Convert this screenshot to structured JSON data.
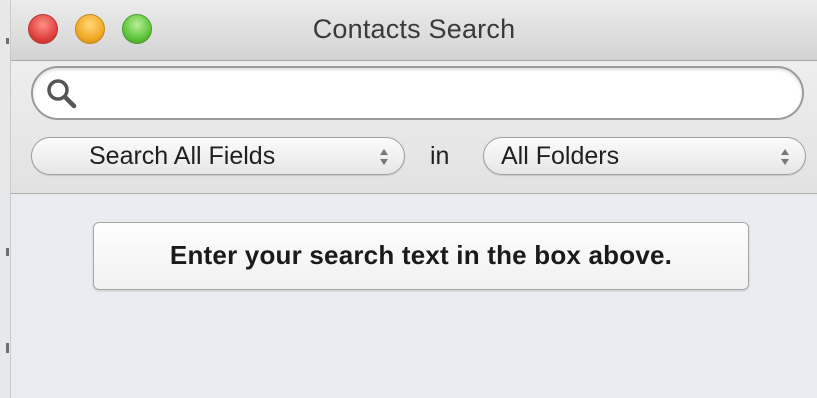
{
  "window": {
    "title": "Contacts Search"
  },
  "search": {
    "value": "",
    "placeholder": ""
  },
  "scope": {
    "field_selected": "Search All Fields",
    "connector": "in",
    "folder_selected": "All Folders"
  },
  "message": {
    "text": "Enter your search text in the box above."
  },
  "icons": {
    "search": "magnifier-icon",
    "stepper": "up-down-arrows-icon"
  },
  "colors": {
    "close": "#e0443e",
    "minimize": "#f2aa26",
    "zoom": "#5fc63b",
    "content_background": "#e9ecf1"
  }
}
